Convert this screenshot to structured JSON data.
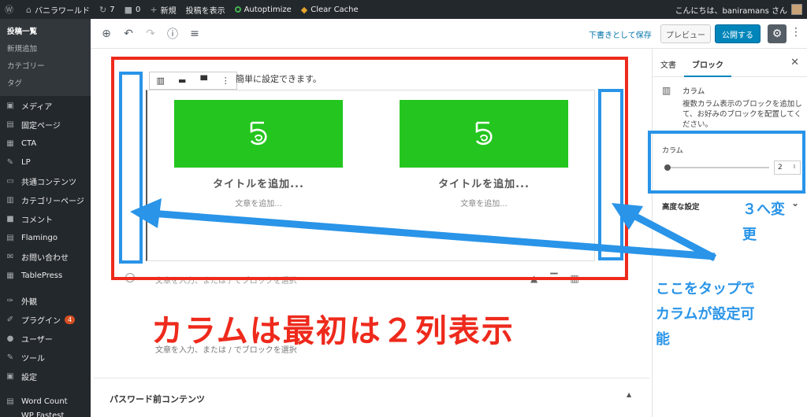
{
  "adminbar": {
    "wp_icon": "wordpress-icon",
    "site_name": "バニラワールド",
    "updates": "7",
    "comments": "0",
    "new": "新規",
    "view_post": "投稿を表示",
    "autoptimize": "Autoptimize",
    "clear_cache": "Clear Cache",
    "greeting": "こんにちは、baniramans さん"
  },
  "sidebar": {
    "sub_items": [
      "投稿一覧",
      "新規追加",
      "カテゴリー",
      "タグ"
    ],
    "items": [
      {
        "label": "メディア",
        "icon": "media-icon",
        "glyph": "▣"
      },
      {
        "label": "固定ページ",
        "icon": "page-icon",
        "glyph": "▤"
      },
      {
        "label": "CTA",
        "icon": "cta-icon",
        "glyph": "▦"
      },
      {
        "label": "LP",
        "icon": "lp-icon",
        "glyph": "✎"
      },
      {
        "label": "共通コンテンツ",
        "icon": "folder-icon",
        "glyph": "▭"
      },
      {
        "label": "カテゴリーページ",
        "icon": "category-page-icon",
        "glyph": "▥"
      },
      {
        "label": "コメント",
        "icon": "comment-icon",
        "glyph": "■"
      },
      {
        "label": "Flamingo",
        "icon": "flamingo-icon",
        "glyph": "▤"
      },
      {
        "label": "お問い合わせ",
        "icon": "mail-icon",
        "glyph": "✉"
      },
      {
        "label": "TablePress",
        "icon": "table-icon",
        "glyph": "▦"
      }
    ],
    "items2": [
      {
        "label": "外観",
        "icon": "appearance-icon",
        "glyph": "✑"
      },
      {
        "label": "プラグイン",
        "icon": "plugin-icon",
        "glyph": "✐",
        "badge": "4"
      },
      {
        "label": "ユーザー",
        "icon": "user-icon",
        "glyph": "●"
      },
      {
        "label": "ツール",
        "icon": "tool-icon",
        "glyph": "✎"
      },
      {
        "label": "設定",
        "icon": "settings-icon",
        "glyph": "▣"
      }
    ],
    "items3": [
      {
        "label": "Word Count",
        "icon": "wordcount-icon",
        "glyph": "▤"
      },
      {
        "label": "WP Fastest Cache",
        "icon": "cache-icon",
        "glyph": "♦"
      }
    ]
  },
  "editor": {
    "save_draft": "下書きとして保存",
    "preview": "プレビュー",
    "publish": "公開する",
    "setup_text": "簡単に設定できます。",
    "columns": [
      {
        "title": "タイトルを追加...",
        "text": "文章を追加..."
      },
      {
        "title": "タイトルを追加...",
        "text": "文章を追加..."
      }
    ],
    "placeholder1": "文章を入力、または / でブロックを選択",
    "placeholder2": "文章を入力、または / でブロックを選択",
    "password_section": "パスワード前コンテンツ"
  },
  "panel": {
    "tab_document": "文書",
    "tab_block": "ブロック",
    "block_name": "カラム",
    "block_desc": "複数カラム表示のブロックを追加して、お好みのブロックを配置してください。",
    "columns_label": "カラム",
    "columns_value": "2",
    "advanced": "高度な設定"
  },
  "annotations": {
    "big_caption": "カラムは最初は２列表示",
    "change_to_3_line1": "３へ変",
    "change_to_3_line2": "更",
    "tap_line1": "ここをタップで",
    "tap_line2": "カラムが設定可",
    "tap_line3": "能",
    "colors": {
      "red": "#ee2a1c",
      "blue": "#2994e8"
    }
  }
}
